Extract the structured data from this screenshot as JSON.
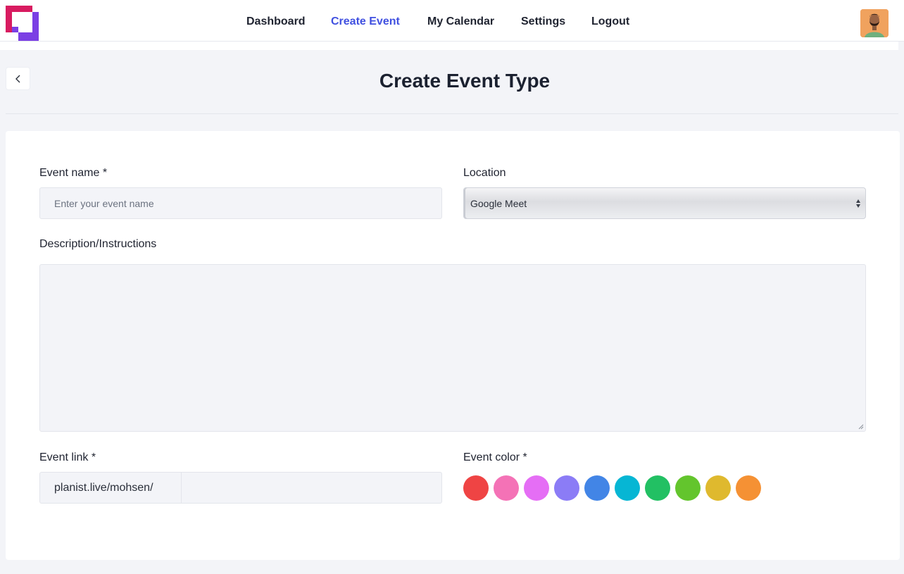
{
  "nav": {
    "items": [
      {
        "label": "Dashboard",
        "active": false
      },
      {
        "label": "Create Event",
        "active": true
      },
      {
        "label": "My Calendar",
        "active": false
      },
      {
        "label": "Settings",
        "active": false
      },
      {
        "label": "Logout",
        "active": false
      }
    ]
  },
  "page": {
    "title": "Create Event Type"
  },
  "form": {
    "event_name": {
      "label": "Event name *",
      "placeholder": "Enter your event name",
      "value": ""
    },
    "location": {
      "label": "Location",
      "value": "Google Meet"
    },
    "description": {
      "label": "Description/Instructions",
      "value": ""
    },
    "event_link": {
      "label": "Event link *",
      "prefix": "planist.live/mohsen/",
      "value": ""
    },
    "event_color": {
      "label": "Event color *",
      "colors": [
        "#ef4444",
        "#f472b6",
        "#e56ef5",
        "#8b7cf6",
        "#4285e6",
        "#06b6d4",
        "#22c063",
        "#63c52d",
        "#dfb92e",
        "#f59134"
      ]
    }
  },
  "colors": {
    "accent": "#4050e0",
    "logo_red": "#d81b60",
    "logo_purple": "#7b3fe4"
  },
  "icons": {
    "back": "chevron-left-icon",
    "logo": "planist-logo-icon",
    "avatar": "user-avatar"
  }
}
